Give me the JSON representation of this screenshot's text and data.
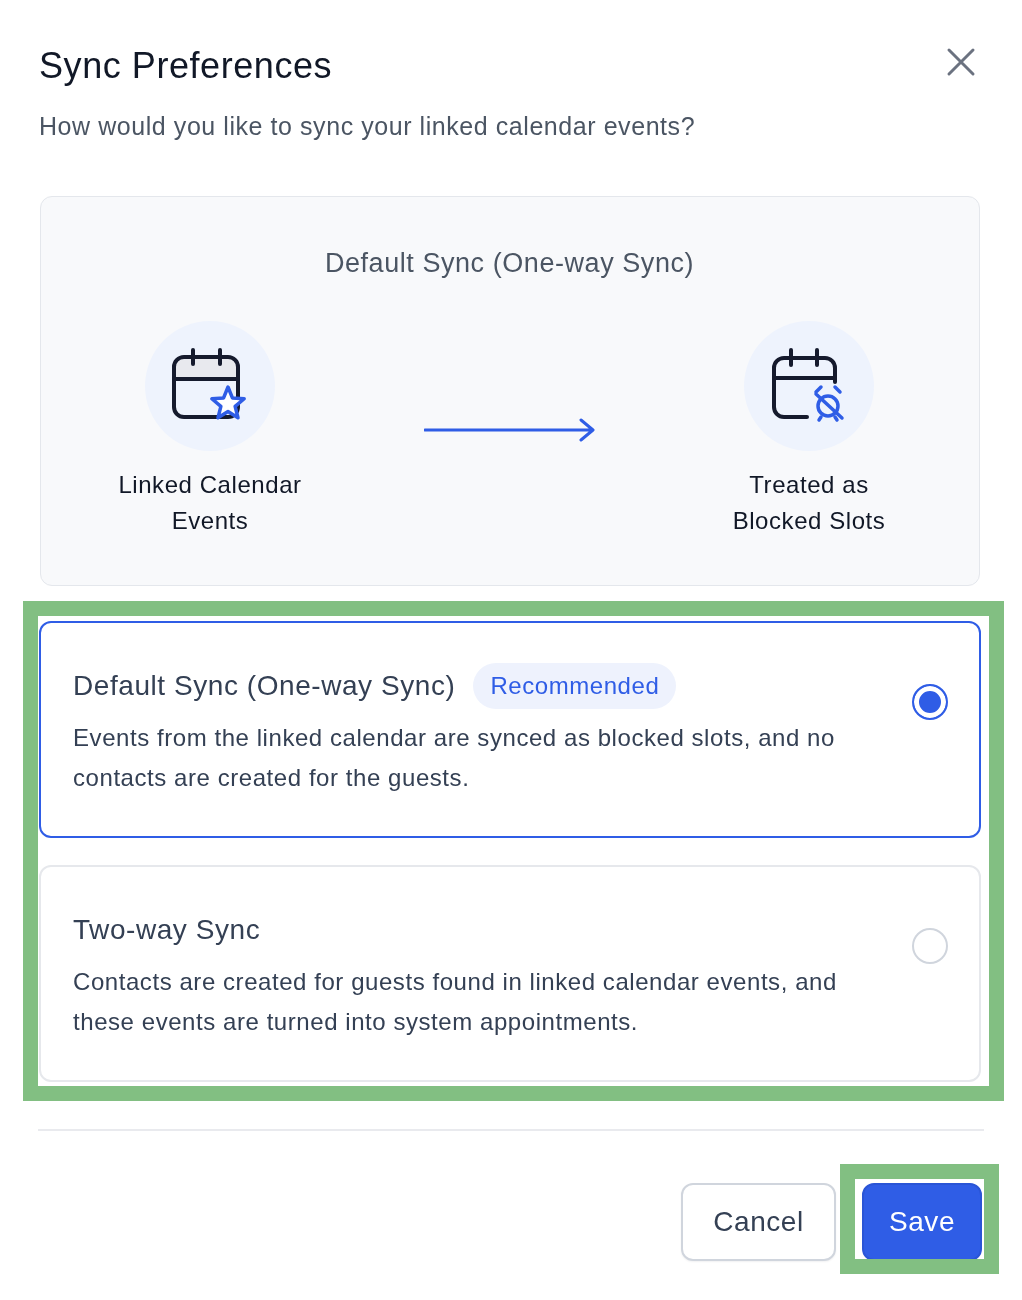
{
  "dialog": {
    "title": "Sync Preferences",
    "subtitle": "How would you like to sync your linked calendar events?"
  },
  "diagram": {
    "title": "Default Sync (One-way Sync)",
    "source": {
      "label": "Linked Calendar Events"
    },
    "target": {
      "label": "Treated as Blocked Slots"
    }
  },
  "options": {
    "highlighted": true,
    "items": [
      {
        "title": "Default Sync (One-way Sync)",
        "badge": "Recommended",
        "description": "Events from the linked calendar are synced as blocked slots, and no contacts are created for the guests.",
        "selected": true
      },
      {
        "title": "Two-way Sync",
        "description": "Contacts are created for guests found in linked calendar events, and these events are turned into system appointments.",
        "selected": false
      }
    ]
  },
  "footer": {
    "buttons": [
      {
        "label": "Cancel",
        "kind": "secondary",
        "highlighted": false
      },
      {
        "label": "Save",
        "kind": "primary",
        "highlighted": true
      }
    ]
  }
}
